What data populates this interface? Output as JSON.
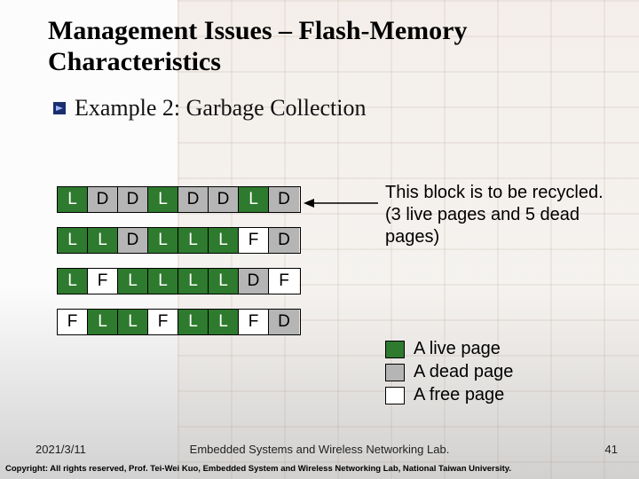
{
  "title": "Management Issues – Flash-Memory Characteristics",
  "subtitle": "Example 2: Garbage Collection",
  "blocks": [
    [
      "L",
      "D",
      "D",
      "L",
      "D",
      "D",
      "L",
      "D"
    ],
    [
      "L",
      "L",
      "D",
      "L",
      "L",
      "L",
      "F",
      "D"
    ],
    [
      "L",
      "F",
      "L",
      "L",
      "L",
      "L",
      "D",
      "F"
    ],
    [
      "F",
      "L",
      "L",
      "F",
      "L",
      "L",
      "F",
      "D"
    ]
  ],
  "cell_class": {
    "L": "live",
    "D": "dead",
    "F": "free"
  },
  "note": {
    "line1": "This block is to be recycled.",
    "line2": "(3 live pages and 5 dead pages)"
  },
  "legend": {
    "live": "A live page",
    "dead": "A dead page",
    "free": "A free page"
  },
  "footer": {
    "date": "2021/3/11",
    "center": "Embedded Systems and Wireless Networking Lab.",
    "page": "41",
    "copyright": "Copyright: All rights reserved, Prof. Tei-Wei Kuo, Embedded System and Wireless Networking Lab, National Taiwan University."
  },
  "colors": {
    "live": "#2e7a2e",
    "dead": "#b5b5b5",
    "free": "#ffffff"
  }
}
